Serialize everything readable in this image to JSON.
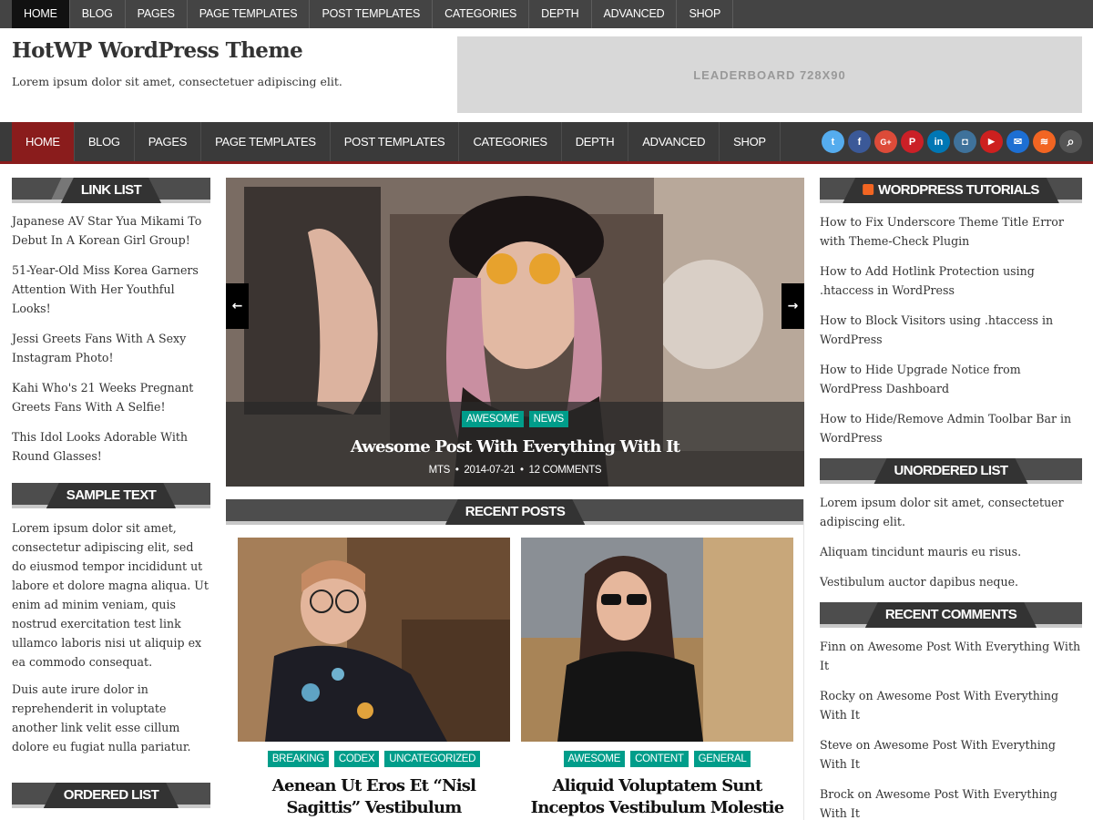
{
  "topnav": [
    "HOME",
    "BLOG",
    "PAGES",
    "PAGE TEMPLATES",
    "POST TEMPLATES",
    "CATEGORIES",
    "DEPTH",
    "ADVANCED",
    "SHOP"
  ],
  "header": {
    "title": "HotWP WordPress Theme",
    "description": "Lorem ipsum dolor sit amet, consectetuer adipiscing elit.",
    "ad_label": "LEADERBOARD 728X90"
  },
  "mainnav": [
    "HOME",
    "BLOG",
    "PAGES",
    "PAGE TEMPLATES",
    "POST TEMPLATES",
    "CATEGORIES",
    "DEPTH",
    "ADVANCED",
    "SHOP"
  ],
  "social": [
    {
      "icon": "twitter-icon",
      "glyph": "t",
      "color": "#55acee"
    },
    {
      "icon": "facebook-icon",
      "glyph": "f",
      "color": "#3b5998"
    },
    {
      "icon": "google-plus-icon",
      "glyph": "G+",
      "color": "#dd4b39"
    },
    {
      "icon": "pinterest-icon",
      "glyph": "P",
      "color": "#cb2027"
    },
    {
      "icon": "linkedin-icon",
      "glyph": "in",
      "color": "#0077b5"
    },
    {
      "icon": "instagram-icon",
      "glyph": "◘",
      "color": "#3f729b"
    },
    {
      "icon": "youtube-icon",
      "glyph": "▶",
      "color": "#cd201f"
    },
    {
      "icon": "email-icon",
      "glyph": "✉",
      "color": "#1d6fd3"
    },
    {
      "icon": "rss-icon",
      "glyph": "≋",
      "color": "#f26522"
    },
    {
      "icon": "search-icon",
      "glyph": "⌕",
      "color": "#555555"
    }
  ],
  "left": {
    "link_list_title": "LINK LIST",
    "links": [
      "Japanese AV Star Yua Mikami To Debut In A Korean Girl Group!",
      "51-Year-Old Miss Korea Garners Attention With Her Youthful Looks!",
      "Jessi Greets Fans With A Sexy Instagram Photo!",
      "Kahi Who's 21 Weeks Pregnant Greets Fans With A Selfie!",
      "This Idol Looks Adorable With Round Glasses!"
    ],
    "sample_title": "SAMPLE TEXT",
    "sample_p1": "Lorem ipsum dolor sit amet, consectetur adipiscing elit, sed do eiusmod tempor incididunt ut labore et dolore magna aliqua. Ut enim ad minim veniam, quis nostrud exercitation test link ullamco laboris nisi ut aliquip ex ea commodo consequat.",
    "sample_p2": "Duis aute irure dolor in reprehenderit in voluptate another link velit esse cillum dolore eu fugiat nulla pariatur.",
    "ordered_title": "ORDERED LIST"
  },
  "slider": {
    "tags": [
      "AWESOME",
      "NEWS"
    ],
    "title": "Awesome Post With Everything With It",
    "author": "MTS",
    "date": "2014-07-21",
    "comments": "12 COMMENTS"
  },
  "recent": {
    "title": "RECENT POSTS",
    "posts": [
      {
        "tags": [
          "BREAKING",
          "CODEX",
          "UNCATEGORIZED"
        ],
        "title": "Aenean Ut Eros Et “Nisl Sagittis” Vestibulum"
      },
      {
        "tags": [
          "AWESOME",
          "CONTENT",
          "GENERAL"
        ],
        "title": "Aliquid Voluptatem Sunt Inceptos Vestibulum Molestie"
      }
    ]
  },
  "right": {
    "tutorials_title": "WORDPRESS TUTORIALS",
    "tutorials": [
      "How to Fix Underscore Theme Title Error with Theme-Check Plugin",
      "How to Add Hotlink Protection using .htaccess in WordPress",
      "How to Block Visitors using .htaccess in WordPress",
      "How to Hide Upgrade Notice from WordPress Dashboard",
      "How to Hide/Remove Admin Toolbar Bar in WordPress"
    ],
    "unordered_title": "UNORDERED LIST",
    "unordered": [
      "Lorem ipsum dolor sit amet, consectetuer adipiscing elit.",
      "Aliquam tincidunt mauris eu risus.",
      "Vestibulum auctor dapibus neque."
    ],
    "comments_title": "RECENT COMMENTS",
    "comments": [
      {
        "author": "Finn",
        "on": "on",
        "post": "Awesome Post With Everything With It"
      },
      {
        "author": "Rocky",
        "on": "on",
        "post": "Awesome Post With Everything With It"
      },
      {
        "author": "Steve",
        "on": "on",
        "post": "Awesome Post With Everything With It"
      },
      {
        "author": "Brock",
        "on": "on",
        "post": "Awesome Post With Everything With It"
      }
    ]
  },
  "colors": {
    "accent": "#8a1c1c",
    "tag": "#009d8a",
    "dark": "#3a3a3a"
  }
}
